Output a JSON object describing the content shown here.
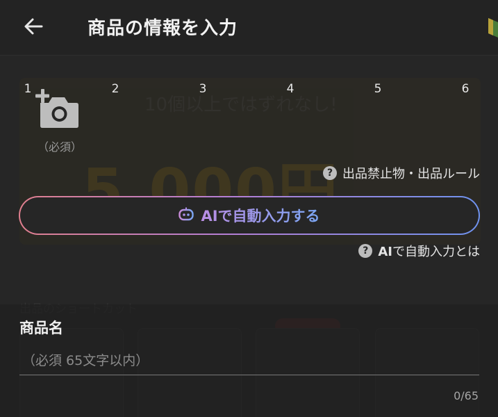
{
  "header": {
    "title": "商品の情報を入力",
    "back_icon": "arrow-left-icon"
  },
  "photos": {
    "slots": [
      "1",
      "2",
      "3",
      "4",
      "5",
      "6"
    ],
    "camera_icon": "camera-add-icon",
    "required_label": "（必須）"
  },
  "rules_link": {
    "label": "出品禁止物・出品ルール",
    "icon": "question-circle-icon"
  },
  "ai_autofill": {
    "button_prefix": "AI",
    "button_suffix": "で自動入力する",
    "icon": "robot-icon",
    "about_prefix": "AI",
    "about_suffix": "で自動入力とは",
    "about_icon": "question-circle-icon"
  },
  "product_name": {
    "label": "商品名",
    "placeholder": "（必須 65文字以内）",
    "value": "",
    "counter": "0/65"
  },
  "colors": {
    "background": "#262626",
    "gradient_start": "#e07f8e",
    "gradient_end": "#6f93ef"
  }
}
